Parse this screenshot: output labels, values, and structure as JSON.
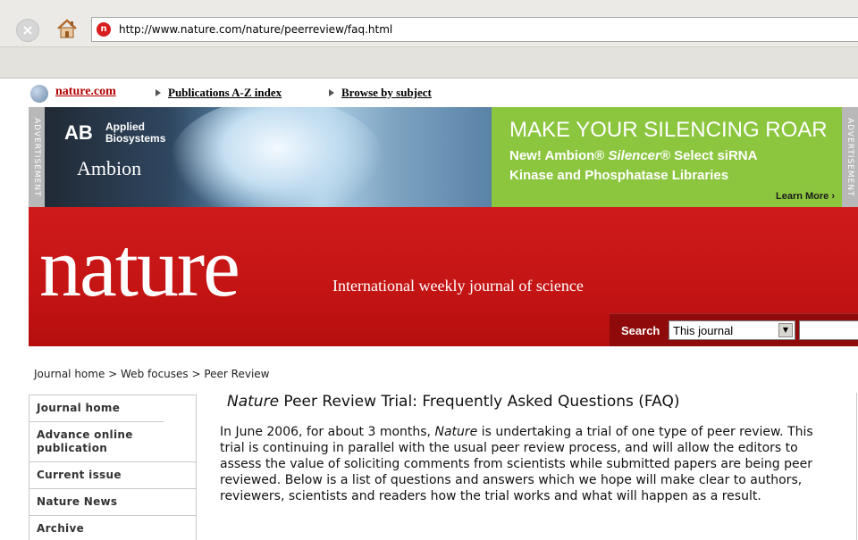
{
  "browser": {
    "url": "http://www.nature.com/nature/peerreview/faq.html",
    "stop_glyph": "×"
  },
  "toplinks": {
    "home": "nature.com",
    "publications": "Publications A-Z index",
    "browse": "Browse by subject"
  },
  "ad": {
    "tag": "ADVERTISEMENT",
    "company_mark": "AB",
    "company_name_line1": "Applied",
    "company_name_line2": "Biosystems",
    "brand": "Ambion",
    "headline": "MAKE YOUR SILENCING ROAR",
    "sub_line1_prefix": "New! Ambion® ",
    "sub_line1_italic": "Silencer®",
    "sub_line1_suffix": " Select siRNA",
    "sub_line2": "Kinase and Phosphatase Libraries",
    "learn_more": "Learn More ›",
    "colors": {
      "green": "#8cc63f"
    }
  },
  "masthead": {
    "logo": "nature",
    "tagline": "International weekly journal of science",
    "search_label": "Search",
    "search_scope": "This journal",
    "colors": {
      "red": "#c41414",
      "dark_red": "#8f0b0b"
    }
  },
  "breadcrumb": "Journal home > Web focuses > Peer Review",
  "sidebar": {
    "items": [
      {
        "label": "Journal home"
      },
      {
        "label": "Advance online publication"
      },
      {
        "label": "Current issue"
      },
      {
        "label": "Nature News"
      },
      {
        "label": "Archive"
      }
    ]
  },
  "article": {
    "title_italic": "Nature",
    "title_rest": " Peer Review Trial: Frequently Asked Questions (FAQ)",
    "intro_before": "In June 2006, for about 3 months, ",
    "intro_italic": "Nature",
    "intro_after": " is undertaking a trial of one type of peer review. This trial is continuing in parallel with the usual peer review process, and will allow the editors to assess the value of soliciting comments from scientists while submitted papers are being peer reviewed. Below is a list of questions and answers which we hope will make clear to authors, reviewers, scientists and readers how the trial works and what will happen as a result."
  }
}
